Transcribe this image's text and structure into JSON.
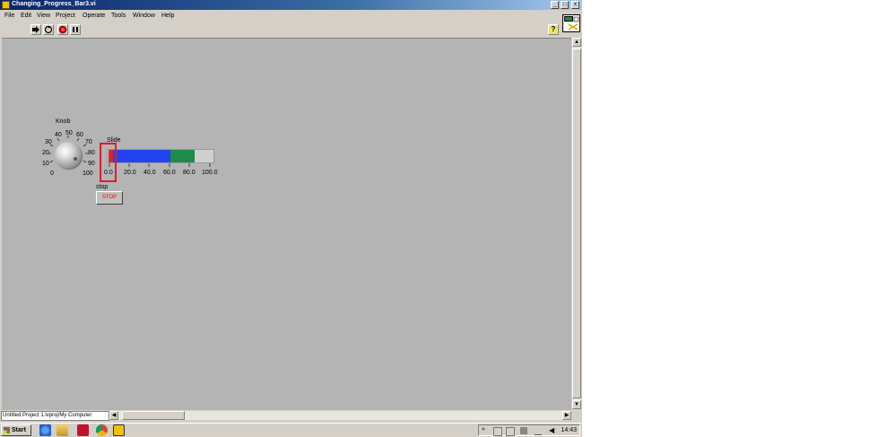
{
  "window": {
    "title": "Changing_Progress_Bar3.vi",
    "controls": {
      "minimize": "_",
      "maximize": "□",
      "close": "x"
    }
  },
  "menu": [
    "File",
    "Edit",
    "View",
    "Project",
    "Operate",
    "Tools",
    "Window",
    "Help"
  ],
  "toolbar": {
    "tools": [
      "run-arrow-icon",
      "run-continuously-icon",
      "abort-icon",
      "pause-icon"
    ],
    "help_glyph": "?"
  },
  "front_panel": {
    "knob": {
      "label": "Knob",
      "ticks": [
        "0",
        "10",
        "20",
        "30",
        "40",
        "50",
        "60",
        "70",
        "80",
        "90",
        "100"
      ],
      "value": 95
    },
    "slide": {
      "label": "Slide",
      "ticks": [
        "0.0",
        "20.0",
        "40.0",
        "60.0",
        "80.0",
        "100.0"
      ],
      "blue_fill_to": 60,
      "green_fill_to": 80,
      "handle_value": 0
    },
    "stop": {
      "label": "stop",
      "button_text": "STOP"
    }
  },
  "statusbar": {
    "path": "Untitled Project 1.lvproj/My Computer"
  },
  "taskbar": {
    "start": "Start",
    "clock": "14:43"
  },
  "colors": {
    "panel_bg": "#b4b4b4",
    "slide_blue": "#2243f0",
    "slide_green": "#1e8a4c",
    "highlight": "#e21b2b"
  }
}
